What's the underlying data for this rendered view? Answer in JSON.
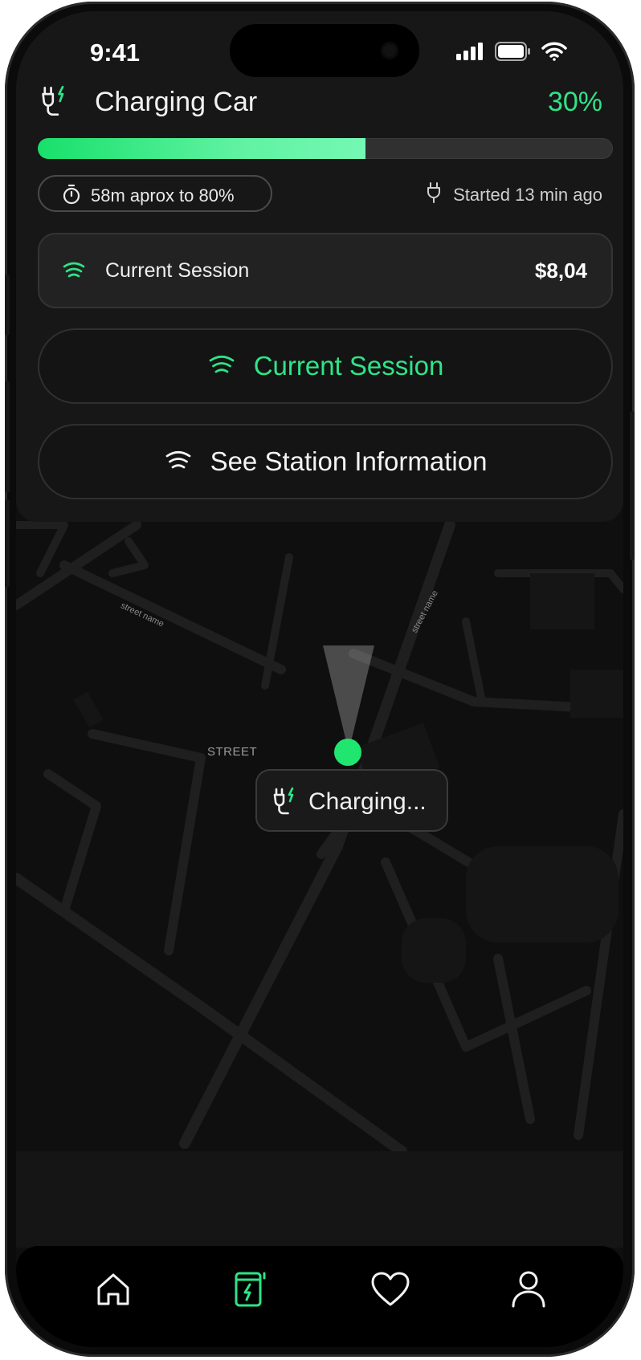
{
  "status_bar": {
    "time": "9:41"
  },
  "header": {
    "title": "Charging Car",
    "percent": "30%",
    "progress_fraction": 0.57
  },
  "info": {
    "eta": "58m aprox to 80%",
    "started": "Started 13 min ago"
  },
  "session_card": {
    "label": "Current Session",
    "amount": "$8,04"
  },
  "buttons": {
    "current_session": "Current Session",
    "station_info": "See Station Information"
  },
  "map": {
    "street_label": "STREET",
    "street_name_1": "street name",
    "street_name_2": "street name",
    "street_name_3": "street"
  },
  "map_tooltip": {
    "label": "Charging..."
  },
  "colors": {
    "accent": "#2fe487",
    "pin": "#20e56f",
    "background": "#0e0e0e"
  },
  "tabbar": {
    "items": [
      "home-icon",
      "charging-station-icon",
      "heart-icon",
      "profile-icon"
    ],
    "active": "charging-station-icon"
  }
}
